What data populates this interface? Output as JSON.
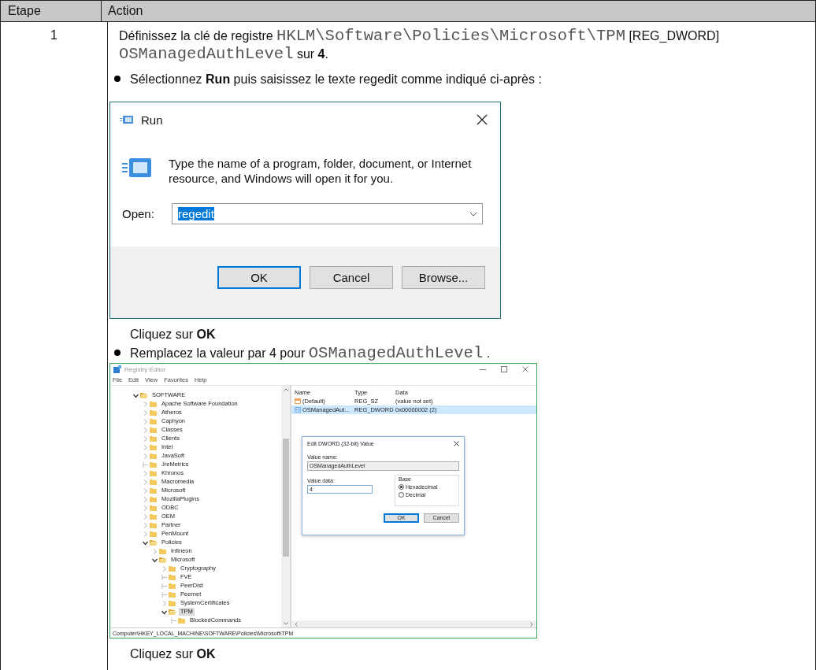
{
  "table": {
    "columns": [
      "Etape",
      "Action"
    ],
    "rows": [
      {
        "step": "1",
        "content": [
          {
            "kind": "paragraph",
            "segments": [
              {
                "kind": "text",
                "text": "Définissez la clé de registre "
              },
              {
                "kind": "code",
                "text": "HKLM\\Software\\Policies\\Microsoft\\TPM"
              },
              {
                "kind": "text",
                "text": " [REG_DWORD] "
              },
              {
                "kind": "code",
                "text": "OSManagedAuthLevel"
              },
              {
                "kind": "text",
                "text": " sur **4**."
              }
            ]
          },
          {
            "kind": "bullet",
            "segments": [
              {
                "kind": "text",
                "text": "Sélectionnez **Run** puis saisissez le texte regedit comme indiqué ci-après :"
              }
            ]
          },
          {
            "kind": "run_dialog",
            "title": "Run",
            "message": "Type the name of a program, folder, document, or Internet resource, and Windows will open it for you.",
            "open_label": "Open:",
            "value": "regedit",
            "text_selected": true,
            "buttons": [
              {
                "label": "OK",
                "default": true
              },
              {
                "label": "Cancel",
                "default": false
              },
              {
                "label": "Browse...",
                "default": false
              }
            ]
          },
          {
            "kind": "note",
            "segments": [
              {
                "kind": "text",
                "text": "Cliquez sur **OK**"
              }
            ]
          },
          {
            "kind": "bullet",
            "segments": [
              {
                "kind": "text",
                "text": "Remplacez la valeur par 4 pour "
              },
              {
                "kind": "code",
                "text": "OSManagedAuthLevel"
              },
              {
                "kind": "text",
                "text": " ."
              }
            ]
          },
          {
            "kind": "registry_editor",
            "title": "Registry Editor",
            "menu": [
              "File",
              "Edit",
              "View",
              "Favorites",
              "Help"
            ],
            "tree": [
              {
                "label": "SOFTWARE",
                "expandable": true,
                "expanded": true,
                "selected": false,
                "children": [
                  {
                    "label": "Apache Software Foundation",
                    "expandable": true,
                    "expanded": false,
                    "selected": false
                  },
                  {
                    "label": "Atheros",
                    "expandable": true,
                    "expanded": false,
                    "selected": false
                  },
                  {
                    "label": "Caphyon",
                    "expandable": true,
                    "expanded": false,
                    "selected": false
                  },
                  {
                    "label": "Classes",
                    "expandable": true,
                    "expanded": false,
                    "selected": false
                  },
                  {
                    "label": "Clients",
                    "expandable": true,
                    "expanded": false,
                    "selected": false
                  },
                  {
                    "label": "Intel",
                    "expandable": true,
                    "expanded": false,
                    "selected": false
                  },
                  {
                    "label": "JavaSoft",
                    "expandable": true,
                    "expanded": false,
                    "selected": false
                  },
                  {
                    "label": "JreMetrics",
                    "expandable": false,
                    "expanded": false,
                    "selected": false
                  },
                  {
                    "label": "Khronos",
                    "expandable": true,
                    "expanded": false,
                    "selected": false
                  },
                  {
                    "label": "Macromedia",
                    "expandable": true,
                    "expanded": false,
                    "selected": false
                  },
                  {
                    "label": "Microsoft",
                    "expandable": true,
                    "expanded": false,
                    "selected": false
                  },
                  {
                    "label": "MozillaPlugins",
                    "expandable": true,
                    "expanded": false,
                    "selected": false
                  },
                  {
                    "label": "ODBC",
                    "expandable": true,
                    "expanded": false,
                    "selected": false
                  },
                  {
                    "label": "OEM",
                    "expandable": true,
                    "expanded": false,
                    "selected": false
                  },
                  {
                    "label": "Partner",
                    "expandable": true,
                    "expanded": false,
                    "selected": false
                  },
                  {
                    "label": "PenMount",
                    "expandable": true,
                    "expanded": false,
                    "selected": false
                  },
                  {
                    "label": "Policies",
                    "expandable": true,
                    "expanded": true,
                    "selected": false,
                    "children": [
                      {
                        "label": "Infineon",
                        "expandable": true,
                        "expanded": false,
                        "selected": false
                      },
                      {
                        "label": "Microsoft",
                        "expandable": true,
                        "expanded": true,
                        "selected": false,
                        "children": [
                          {
                            "label": "Cryptography",
                            "expandable": true,
                            "expanded": false,
                            "selected": false
                          },
                          {
                            "label": "FVE",
                            "expandable": false,
                            "expanded": false,
                            "selected": false
                          },
                          {
                            "label": "PeerDist",
                            "expandable": false,
                            "expanded": false,
                            "selected": false
                          },
                          {
                            "label": "Peernet",
                            "expandable": false,
                            "expanded": false,
                            "selected": false
                          },
                          {
                            "label": "SystemCertificates",
                            "expandable": true,
                            "expanded": false,
                            "selected": false
                          },
                          {
                            "label": "TPM",
                            "expandable": true,
                            "expanded": true,
                            "selected": true,
                            "children": [
                              {
                                "label": "BlockedCommands",
                                "expandable": false,
                                "expanded": false,
                                "selected": false
                              }
                            ]
                          }
                        ]
                      }
                    ]
                  }
                ]
              }
            ],
            "columns": [
              "Name",
              "Type",
              "Data"
            ],
            "values": [
              {
                "kind": "string",
                "name": "(Default)",
                "type": "REG_SZ",
                "data": "(value not set)",
                "selected": false
              },
              {
                "kind": "binary",
                "name": "OSManagedAut...",
                "type": "REG_DWORD",
                "data": "0x00000002 (2)",
                "selected": true
              }
            ],
            "dialog": {
              "title": "Edit DWORD (32-bit) Value",
              "value_name_label": "Value name:",
              "value_name": "OSManagedAuthLevel",
              "value_data_label": "Value data:",
              "value_data": "4",
              "base_label": "Base",
              "radios": [
                {
                  "label": "Hexadecimal",
                  "selected": true
                },
                {
                  "label": "Decimal",
                  "selected": false
                }
              ],
              "buttons": [
                {
                  "label": "OK",
                  "default": true
                },
                {
                  "label": "Cancel",
                  "default": false
                }
              ]
            },
            "status": "Computer\\HKEY_LOCAL_MACHINE\\SOFTWARE\\Policies\\Microsoft\\TPM"
          },
          {
            "kind": "note",
            "segments": [
              {
                "kind": "text",
                "text": "Cliquez sur **OK**"
              }
            ]
          }
        ]
      }
    ]
  }
}
